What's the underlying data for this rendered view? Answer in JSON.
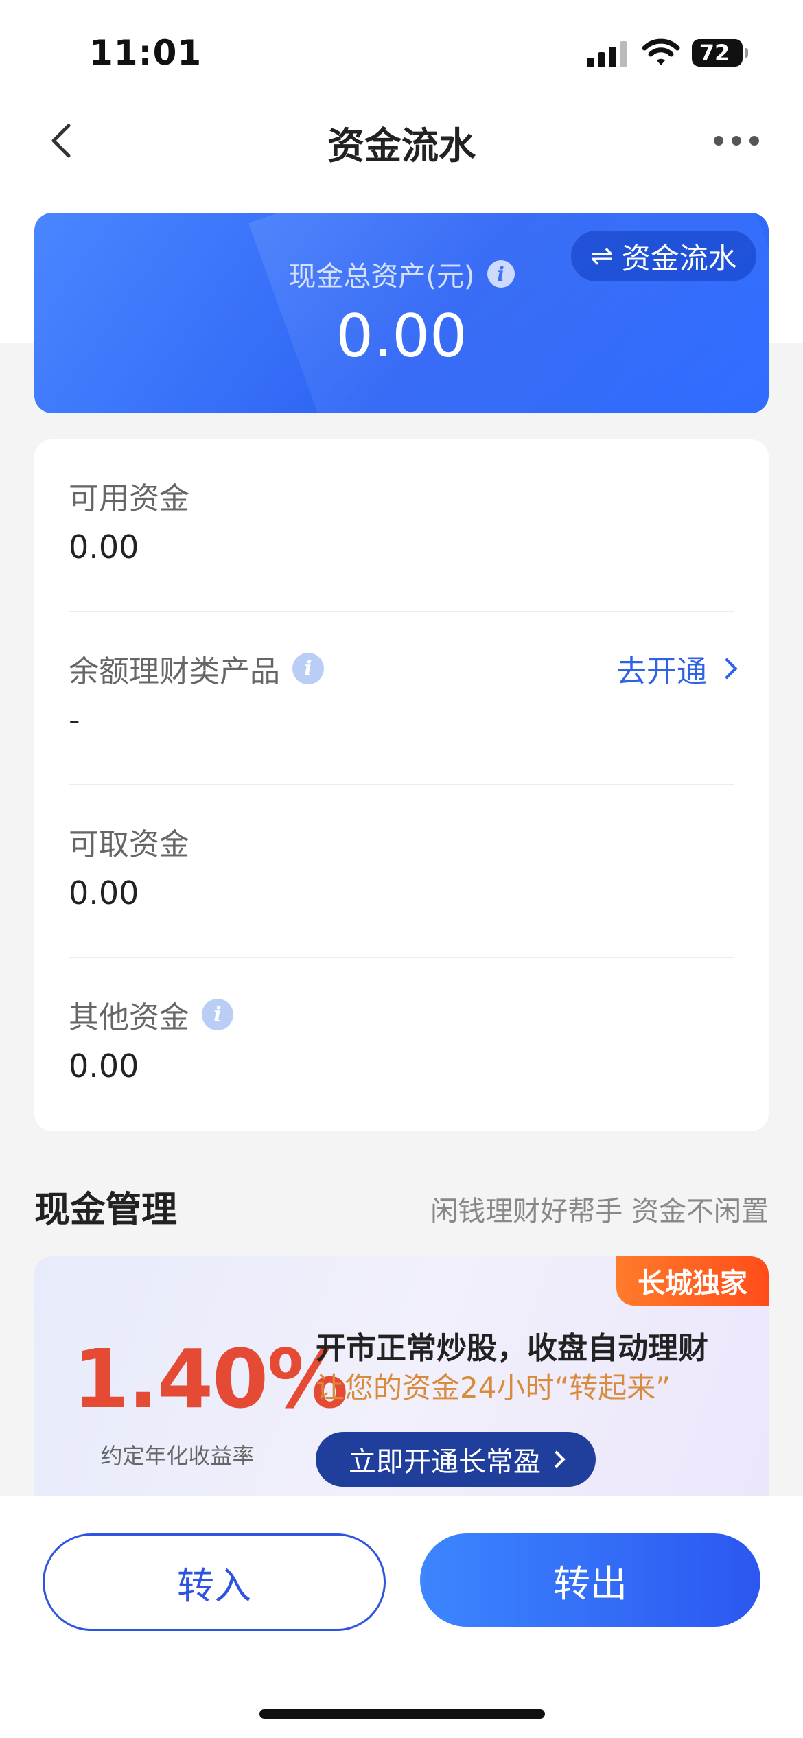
{
  "status_bar": {
    "time": "11:01",
    "battery": "72"
  },
  "nav": {
    "title": "资金流水"
  },
  "asset_card": {
    "chip_label": "资金流水",
    "total_label": "现金总资产(元)",
    "total_value": "0.00"
  },
  "funds": {
    "available": {
      "label": "可用资金",
      "value": "0.00"
    },
    "balance_products": {
      "label": "余额理财类产品",
      "value": "-",
      "link": "去开通"
    },
    "withdrawable": {
      "label": "可取资金",
      "value": "0.00"
    },
    "other": {
      "label": "其他资金",
      "value": "0.00"
    }
  },
  "cash_management": {
    "title": "现金管理",
    "subtitle": "闲钱理财好帮手 资金不闲置"
  },
  "promo": {
    "badge": "长城独家",
    "rate": "1.40%",
    "rate_label": "约定年化收益率",
    "headline": "开市正常炒股，收盘自动理财",
    "subline": "让您的资金24小时“转起来”",
    "button": "立即开通长常盈"
  },
  "actions": {
    "transfer_in": "转入",
    "transfer_out": "转出"
  },
  "colors": {
    "brand_blue": "#2c63f5",
    "link_blue": "#2f62e6",
    "rate_red": "#e54a35",
    "badge_orange": "#ff5a1f"
  }
}
